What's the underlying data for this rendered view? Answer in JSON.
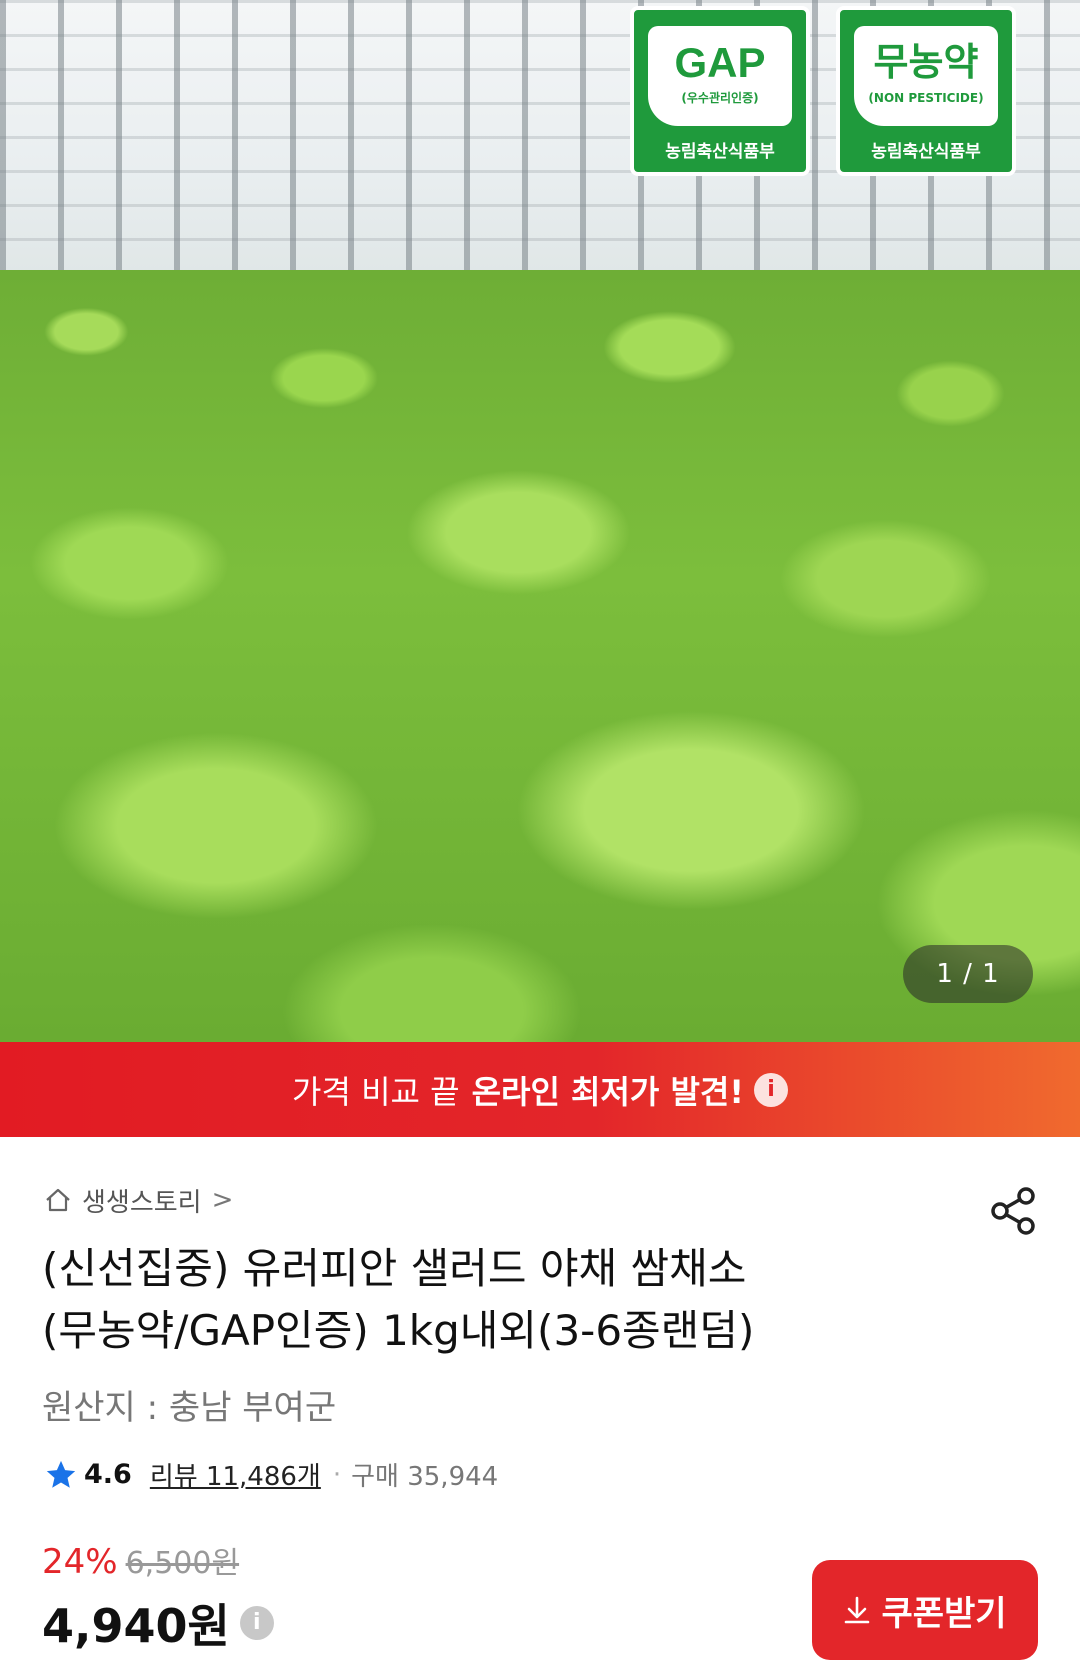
{
  "hero": {
    "cert_gap": {
      "big": "GAP",
      "small": "(우수관리인증)",
      "foot": "농림축산식품부"
    },
    "cert_np": {
      "big": "무농약",
      "small": "(NON PESTICIDE)",
      "foot": "농림축산식품부"
    },
    "counter": "1 / 1"
  },
  "promo": {
    "light": "가격 비교 끝",
    "bold": "온라인 최저가 발견!",
    "info": "i"
  },
  "store": {
    "name": "생생스토리",
    "chevron": ">"
  },
  "product": {
    "title_line1": "(신선집중) 유러피안 샐러드 야채 쌈채소",
    "title_line2": "(무농약/GAP인증) 1kg내외(3-6종랜덤)",
    "origin": "원산지 : 충남 부여군"
  },
  "rating": {
    "score": "4.6",
    "reviews": "리뷰 11,486개",
    "dot": "·",
    "sold": "구매 35,944"
  },
  "pricing": {
    "discount": "24%",
    "original": "6,500원",
    "price": "4,940원",
    "info": "i"
  },
  "coupon": {
    "label": "쿠폰받기"
  },
  "colors": {
    "accent": "#e3262a",
    "cert_green": "#1f9a3c"
  }
}
